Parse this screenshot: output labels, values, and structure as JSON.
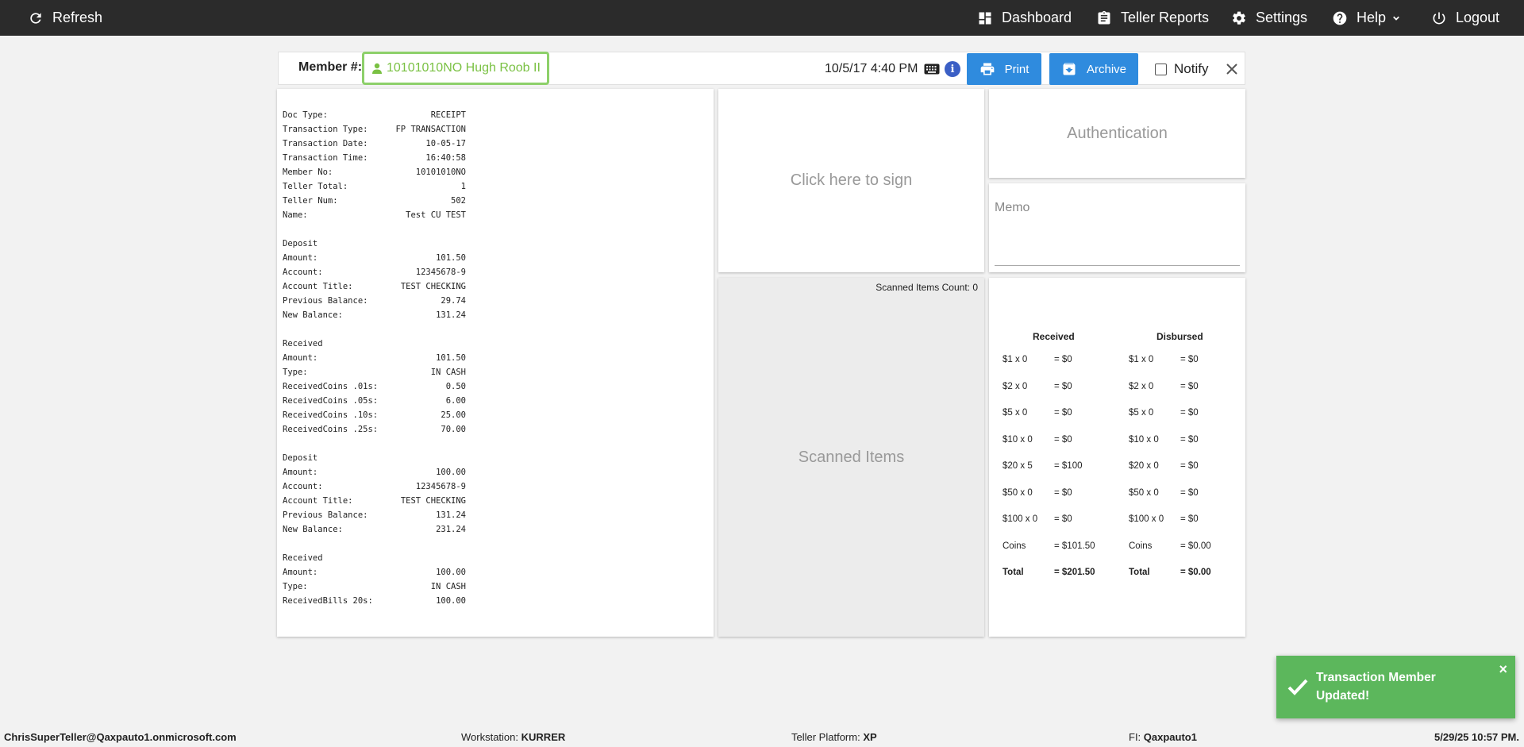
{
  "nav": {
    "refresh": "Refresh",
    "dashboard": "Dashboard",
    "teller_reports": "Teller Reports",
    "settings": "Settings",
    "help": "Help",
    "logout": "Logout"
  },
  "member_bar": {
    "label": "Member #:",
    "member_value": "10101010NO Hugh Roob II",
    "datetime": "10/5/17 4:40 PM",
    "print": "Print",
    "archive": "Archive",
    "notify": "Notify"
  },
  "receipt": {
    "lines": [
      {
        "label": "Doc Type:",
        "value": "RECEIPT"
      },
      {
        "label": "Transaction Type:",
        "value": "FP TRANSACTION"
      },
      {
        "label": "Transaction Date:",
        "value": "10-05-17"
      },
      {
        "label": "Transaction Time:",
        "value": "16:40:58"
      },
      {
        "label": "Member No:",
        "value": "10101010NO"
      },
      {
        "label": "Teller Total:",
        "value": "1"
      },
      {
        "label": "Teller Num:",
        "value": "502"
      },
      {
        "label": "Name:",
        "value": "Test CU TEST"
      },
      {
        "label": "",
        "value": ""
      },
      {
        "label": "Deposit",
        "value": ""
      },
      {
        "label": "Amount:",
        "value": "101.50"
      },
      {
        "label": "Account:",
        "value": "12345678-9"
      },
      {
        "label": "Account Title:",
        "value": "TEST CHECKING"
      },
      {
        "label": "Previous Balance:",
        "value": "29.74"
      },
      {
        "label": "New Balance:",
        "value": "131.24"
      },
      {
        "label": "",
        "value": ""
      },
      {
        "label": "Received",
        "value": ""
      },
      {
        "label": "Amount:",
        "value": "101.50"
      },
      {
        "label": "Type:",
        "value": "IN CASH"
      },
      {
        "label": "ReceivedCoins .01s:",
        "value": "0.50"
      },
      {
        "label": "ReceivedCoins .05s:",
        "value": "6.00"
      },
      {
        "label": "ReceivedCoins .10s:",
        "value": "25.00"
      },
      {
        "label": "ReceivedCoins .25s:",
        "value": "70.00"
      },
      {
        "label": "",
        "value": ""
      },
      {
        "label": "Deposit",
        "value": ""
      },
      {
        "label": "Amount:",
        "value": "100.00"
      },
      {
        "label": "Account:",
        "value": "12345678-9"
      },
      {
        "label": "Account Title:",
        "value": "TEST CHECKING"
      },
      {
        "label": "Previous Balance:",
        "value": "131.24"
      },
      {
        "label": "New Balance:",
        "value": "231.24"
      },
      {
        "label": "",
        "value": ""
      },
      {
        "label": "Received",
        "value": ""
      },
      {
        "label": "Amount:",
        "value": "100.00"
      },
      {
        "label": "Type:",
        "value": "IN CASH"
      },
      {
        "label": "ReceivedBills 20s:",
        "value": "100.00"
      }
    ]
  },
  "signature": {
    "prompt": "Click here to sign"
  },
  "scanned": {
    "count_label": "Scanned Items Count: 0",
    "title": "Scanned Items"
  },
  "auth": {
    "label": "Authentication"
  },
  "memo": {
    "label": "Memo"
  },
  "cash": {
    "received_header": "Received",
    "disbursed_header": "Disbursed",
    "rows": [
      {
        "r_denom": "$1 x 0",
        "r_total": "= $0",
        "d_denom": "$1 x 0",
        "d_total": "= $0"
      },
      {
        "r_denom": "$2 x 0",
        "r_total": "= $0",
        "d_denom": "$2 x 0",
        "d_total": "= $0"
      },
      {
        "r_denom": "$5 x 0",
        "r_total": "= $0",
        "d_denom": "$5 x 0",
        "d_total": "= $0"
      },
      {
        "r_denom": "$10 x 0",
        "r_total": "= $0",
        "d_denom": "$10 x 0",
        "d_total": "= $0"
      },
      {
        "r_denom": "$20 x 5",
        "r_total": "= $100",
        "d_denom": "$20 x 0",
        "d_total": "= $0"
      },
      {
        "r_denom": "$50 x 0",
        "r_total": "= $0",
        "d_denom": "$50 x 0",
        "d_total": "= $0"
      },
      {
        "r_denom": "$100 x 0",
        "r_total": "= $0",
        "d_denom": "$100 x 0",
        "d_total": "= $0"
      },
      {
        "r_denom": "Coins",
        "r_total": "= $101.50",
        "d_denom": "Coins",
        "d_total": "= $0.00"
      },
      {
        "r_denom": "Total",
        "r_total": "= $201.50",
        "d_denom": "Total",
        "d_total": "= $0.00"
      }
    ]
  },
  "toast": {
    "message": "Transaction Member Updated!",
    "close": "×"
  },
  "status": {
    "user": "ChrisSuperTeller@Qaxpauto1.onmicrosoft.com",
    "workstation_label": "Workstation:",
    "workstation": "KURRER",
    "platform_label": "Teller Platform:",
    "platform": "XP",
    "fi_label": "FI:",
    "fi": "Qaxpauto1",
    "datetime": "5/29/25 10:57 PM."
  },
  "colors": {
    "nav_bg": "#2b2b2b",
    "accent_blue": "#2f8bde",
    "member_green": "#7ac143",
    "toast_green": "#5cb75c"
  }
}
